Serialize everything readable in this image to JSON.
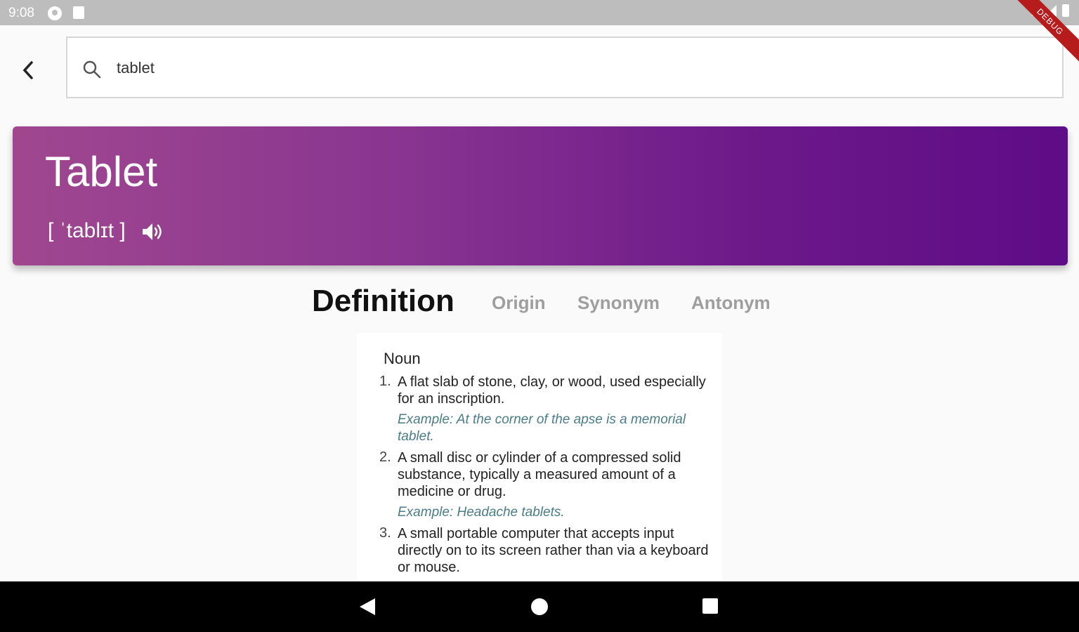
{
  "status_bar": {
    "time": "9:08",
    "ribbon": "DEBUG"
  },
  "search": {
    "value": "tablet",
    "placeholder": ""
  },
  "word": {
    "title": "Tablet",
    "phonetic": "[ ˈtablɪt ]"
  },
  "tabs": [
    {
      "label": "Definition",
      "active": true
    },
    {
      "label": "Origin",
      "active": false
    },
    {
      "label": "Synonym",
      "active": false
    },
    {
      "label": "Antonym",
      "active": false
    }
  ],
  "definition": {
    "part_of_speech": "Noun",
    "senses": [
      {
        "num": "1.",
        "text": "A flat slab of stone, clay, or wood, used especially for an inscription.",
        "example": "Example: At the corner of the apse is a memorial tablet."
      },
      {
        "num": "2.",
        "text": "A small disc or cylinder of a compressed solid substance, typically a measured amount of a medicine or drug.",
        "example": "Example: Headache tablets."
      },
      {
        "num": "3.",
        "text": "A small portable computer that accepts input directly on to its screen rather than via a keyboard or mouse.",
        "example": ""
      }
    ]
  },
  "colors": {
    "gradient_start": "#a0478f",
    "gradient_end": "#5e0c87",
    "example_text": "#4a7d86"
  },
  "icons": [
    "back-arrow-icon",
    "search-icon",
    "speaker-icon",
    "wifi-icon",
    "signal-icon",
    "battery-icon"
  ]
}
